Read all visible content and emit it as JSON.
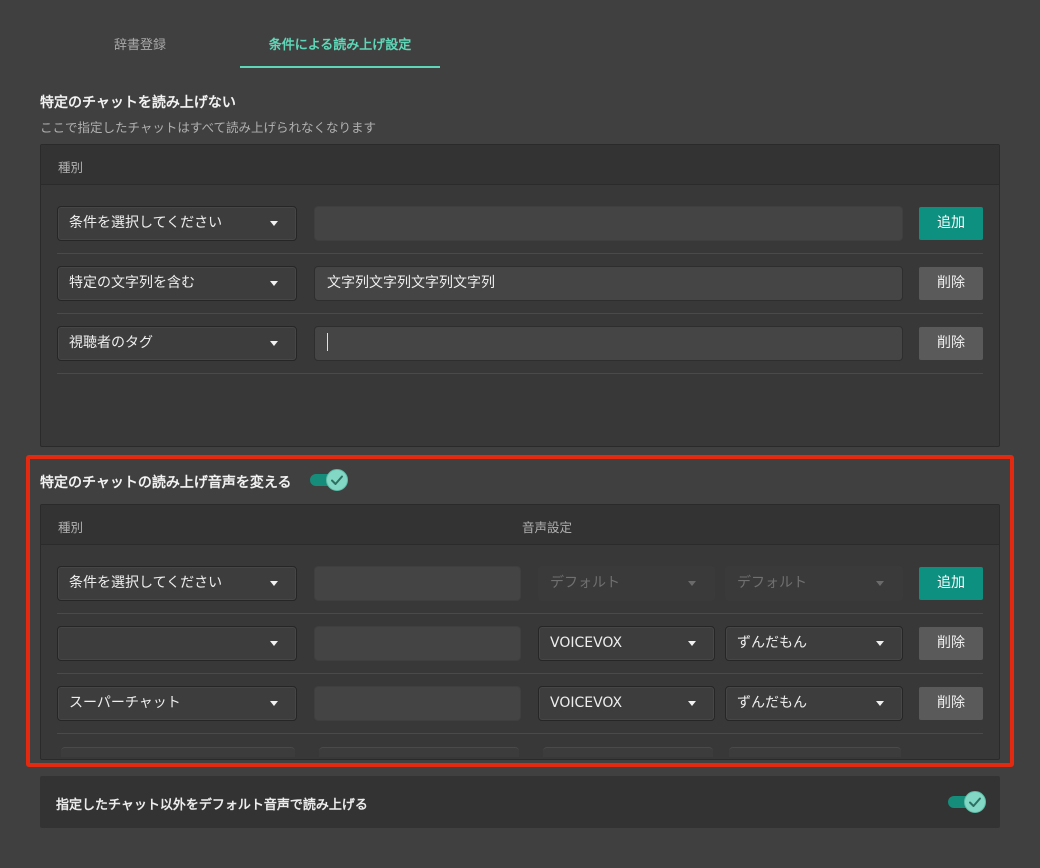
{
  "tabs": [
    {
      "label": "辞書登録",
      "active": false
    },
    {
      "label": "条件による読み上げ設定",
      "active": true
    }
  ],
  "mute_section": {
    "title": "特定のチャットを読み上げない",
    "subtitle": "ここで指定したチャットはすべて読み上げられなくなります",
    "column_type": "種別",
    "rows": [
      {
        "condition": "条件を選択してください",
        "value": "",
        "button": "追加"
      },
      {
        "condition": "特定の文字列を含む",
        "value": "文字列文字列文字列文字列",
        "button": "削除"
      },
      {
        "condition": "視聴者のタグ",
        "value": "",
        "button": "削除"
      }
    ]
  },
  "voice_section": {
    "title": "特定のチャットの読み上げ音声を変える",
    "toggle_on": true,
    "column_type": "種別",
    "column_voice": "音声設定",
    "rows": [
      {
        "condition": "条件を選択してください",
        "value": "",
        "engine": "デフォルト",
        "voice": "デフォルト",
        "button": "追加"
      },
      {
        "condition": "",
        "value": "",
        "engine": "VOICEVOX",
        "voice": "ずんだもん",
        "button": "削除"
      },
      {
        "condition": "スーパーチャット",
        "value": "",
        "engine": "VOICEVOX",
        "voice": "ずんだもん",
        "button": "削除"
      }
    ]
  },
  "default_voice_bar": {
    "label": "指定したチャット以外をデフォルト音声で読み上げる",
    "toggle_on": true
  },
  "colors": {
    "accent": "#5fd6b7",
    "add_button": "#0e9080",
    "highlight": "#e32a11"
  }
}
